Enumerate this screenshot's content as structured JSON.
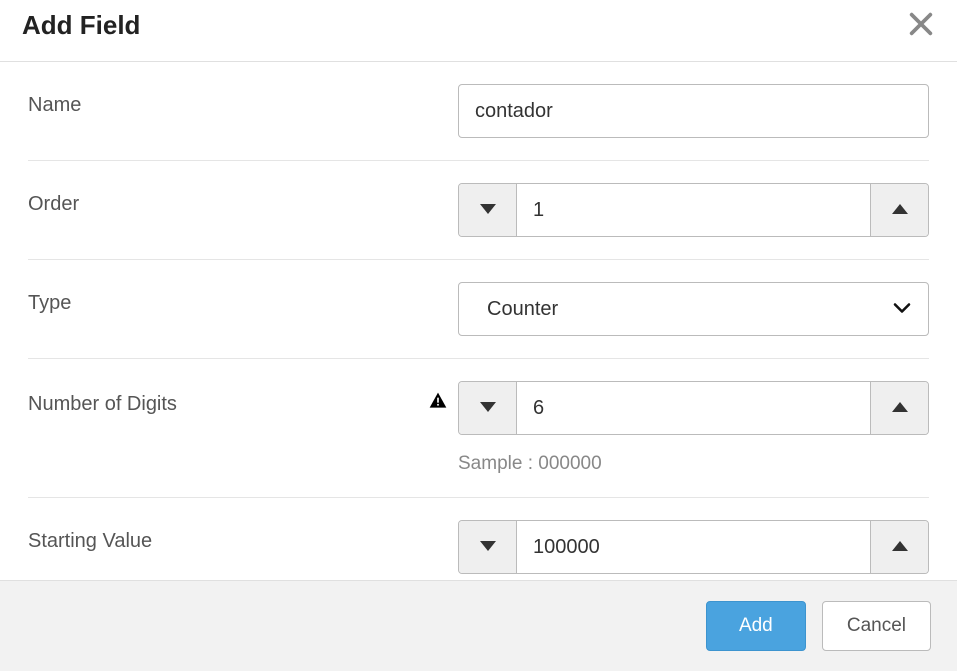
{
  "dialog": {
    "title": "Add Field"
  },
  "form": {
    "name": {
      "label": "Name",
      "value": "contador"
    },
    "order": {
      "label": "Order",
      "value": "1"
    },
    "type": {
      "label": "Type",
      "selected": "Counter"
    },
    "digits": {
      "label": "Number of Digits",
      "value": "6",
      "sample_label": "Sample : 000000"
    },
    "start": {
      "label": "Starting Value",
      "value": "100000"
    }
  },
  "footer": {
    "add": "Add",
    "cancel": "Cancel"
  }
}
